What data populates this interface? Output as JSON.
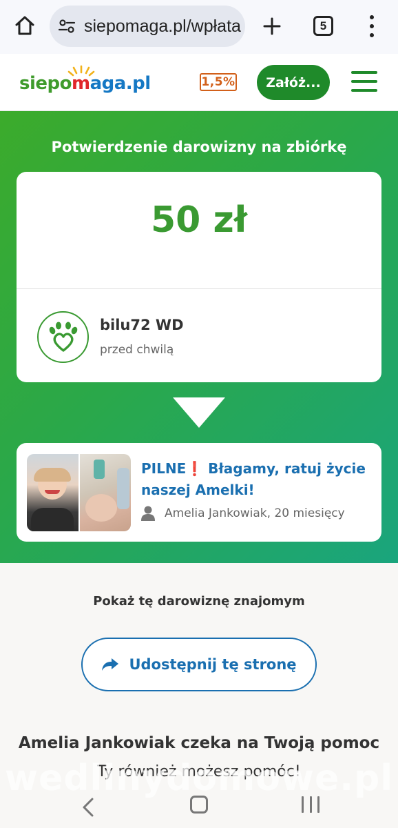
{
  "browser": {
    "url": "siepomaga.pl/wpłata",
    "tab_count": "5",
    "icons": [
      "home-icon",
      "site-settings-icon",
      "plus-icon",
      "tabs-icon",
      "more-vert-icon"
    ]
  },
  "header": {
    "logo_part1": "siepo",
    "logo_part2": "m",
    "logo_part3": "aga",
    "logo_part4": ".pl",
    "percent_badge": "1,5%",
    "found_button": "Załóż...",
    "menu_icon": "hamburger-icon"
  },
  "confirmation": {
    "title": "Potwierdzenie darowizny na zbiórkę",
    "amount": "50 zł",
    "donor_name": "bilu72 WD",
    "donor_time": "przed chwilą",
    "donor_avatar_icon": "paw-heart-icon"
  },
  "campaign": {
    "title_prefix": "PILNE",
    "title_excl": "❗",
    "title_main": "Błagamy, ratuj życie naszej Amelki!",
    "author": "Amelia Jankowiak, 20 miesięcy",
    "author_icon": "person-icon"
  },
  "share": {
    "prompt": "Pokaż tę darowiznę znajomym",
    "button_label": "Udostępnij tę stronę",
    "button_icon": "share-arrow-icon"
  },
  "footer": {
    "waiting_title": "Amelia Jankowiak czeka na Twoją pomoc",
    "you_can_help": "Ty również możesz pomóc!"
  },
  "watermark": "wedlinydomowe.pl",
  "colors": {
    "brand_green": "#3a9a32",
    "brand_blue": "#1a6fb0",
    "cta_green": "#1f8a2a",
    "badge_orange": "#d2601a"
  }
}
